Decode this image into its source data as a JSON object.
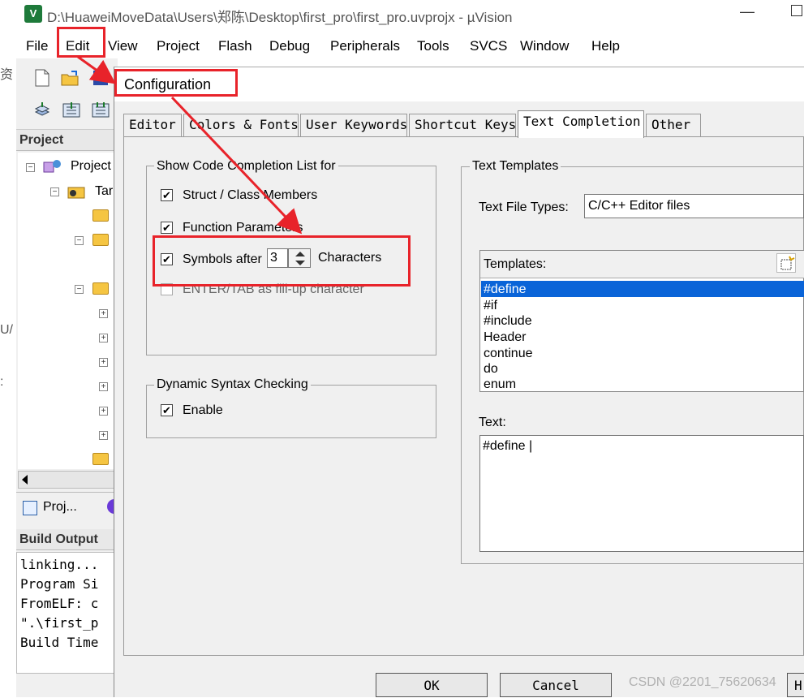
{
  "window": {
    "title": "D:\\HuaweiMoveData\\Users\\郑陈\\Desktop\\first_pro\\first_pro.uvprojx - µVision",
    "app_icon_label": "V",
    "minimize_glyph": "—"
  },
  "menubar": [
    "File",
    "Edit",
    "View",
    "Project",
    "Flash",
    "Debug",
    "Peripherals",
    "Tools",
    "SVCS",
    "Window",
    "Help"
  ],
  "left_edge_chars": [
    "资",
    "U/",
    ":"
  ],
  "project_panel": {
    "header": "Project",
    "root_label": "Project",
    "target_label": "Tar",
    "tab_label": "Proj..."
  },
  "build_output": {
    "header": "Build Output",
    "lines": [
      "linking...",
      "Program Si",
      "FromELF: c",
      "\".\\first_p",
      "Build Time"
    ]
  },
  "dialog": {
    "title": "Configuration",
    "tabs": [
      "Editor",
      "Colors & Fonts",
      "User Keywords",
      "Shortcut Keys",
      "Text Completion",
      "Other"
    ],
    "active_tab": "Text Completion",
    "completion_group": {
      "label": "Show Code Completion List for",
      "struct_members": "Struct / Class Members",
      "function_params": "Function Parameters",
      "symbols_after": "Symbols after",
      "symbols_count": "3",
      "characters": "Characters",
      "enter_tab": "ENTER/TAB as fill-up character"
    },
    "syntax_group": {
      "label": "Dynamic Syntax Checking",
      "enable": "Enable"
    },
    "templates_group": {
      "label": "Text Templates",
      "file_types_label": "Text File Types:",
      "file_types_value": "C/C++ Editor files",
      "templates_label": "Templates:",
      "templates": [
        "#define",
        "#if",
        "#include",
        "Header",
        "continue",
        "do",
        "enum"
      ],
      "selected_template": "#define",
      "text_label": "Text:",
      "text_value": "#define |"
    },
    "buttons": {
      "ok": "OK",
      "cancel": "Cancel",
      "help_partial": "H"
    }
  },
  "watermark": "CSDN @2201_75620634",
  "colors": {
    "annotation": "#e8232a",
    "selection": "#0a64d8"
  }
}
